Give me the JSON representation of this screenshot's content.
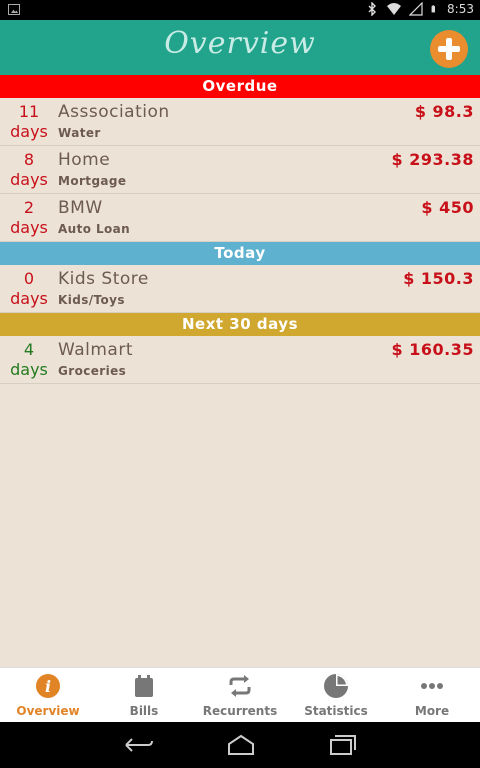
{
  "status_bar": {
    "time": "8:53"
  },
  "app_bar": {
    "title": "Overview"
  },
  "sections": [
    {
      "title": "Overdue",
      "color": "#ff0000",
      "items": [
        {
          "days": "11",
          "days_label": "days",
          "name": "Asssociation",
          "category": "Water",
          "amount": "$ 98.3"
        },
        {
          "days": "8",
          "days_label": "days",
          "name": "Home",
          "category": "Mortgage",
          "amount": "$ 293.38"
        },
        {
          "days": "2",
          "days_label": "days",
          "name": "BMW",
          "category": "Auto Loan",
          "amount": "$ 450"
        }
      ]
    },
    {
      "title": "Today",
      "color": "#5fb2cf",
      "items": [
        {
          "days": "0",
          "days_label": "days",
          "name": "Kids Store",
          "category": "Kids/Toys",
          "amount": "$ 150.3"
        }
      ]
    },
    {
      "title": "Next 30 days",
      "color": "#d0a82f",
      "items": [
        {
          "days": "4",
          "days_label": "days",
          "name": "Walmart",
          "category": "Groceries",
          "amount": "$ 160.35"
        }
      ]
    }
  ],
  "colors": {
    "overdue_days": "#c8101a",
    "upcoming_days": "#237a1f",
    "accent": "#e18426",
    "appbar": "#21a38c"
  },
  "tabs": [
    {
      "label": "Overview",
      "icon": "info-icon",
      "active": true
    },
    {
      "label": "Bills",
      "icon": "calendar-icon",
      "active": false
    },
    {
      "label": "Recurrents",
      "icon": "repeat-icon",
      "active": false
    },
    {
      "label": "Statistics",
      "icon": "pie-chart-icon",
      "active": false
    },
    {
      "label": "More",
      "icon": "more-dots-icon",
      "active": false
    }
  ]
}
